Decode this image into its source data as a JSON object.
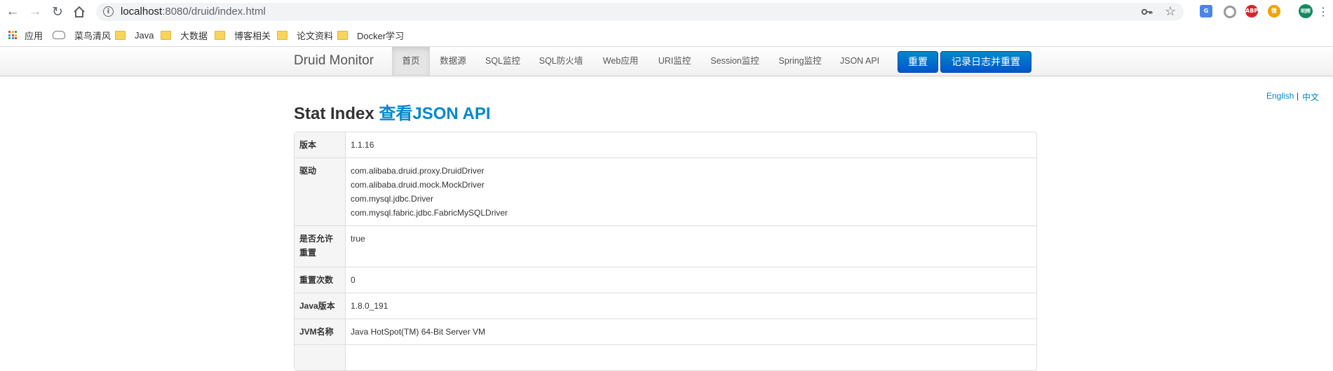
{
  "browser": {
    "url_host": "localhost",
    "url_rest": ":8080/druid/index.html",
    "bookmarks": [
      {
        "label": "应用",
        "icon": "apps-grid-icon"
      },
      {
        "label": "菜鸟清风",
        "icon": "cloud-icon"
      },
      {
        "label": "Java",
        "icon": "folder-icon"
      },
      {
        "label": "大数据",
        "icon": "folder-icon"
      },
      {
        "label": "博客相关",
        "icon": "folder-icon"
      },
      {
        "label": "论文资料",
        "icon": "folder-icon"
      },
      {
        "label": "Docker学习",
        "icon": "folder-icon"
      }
    ],
    "extensions": {
      "abp": "ABP",
      "profile": "明辉"
    }
  },
  "druid": {
    "brand": "Druid Monitor",
    "nav": [
      "首页",
      "数据源",
      "SQL监控",
      "SQL防火墙",
      "Web应用",
      "URI监控",
      "Session监控",
      "Spring监控",
      "JSON API"
    ],
    "reset_button": "重置",
    "log_reset_button": "记录日志并重置"
  },
  "lang": {
    "english": "English",
    "separator": "|",
    "chinese": "中文"
  },
  "page": {
    "title": "Stat Index",
    "json_link": "查看JSON API"
  },
  "stats": {
    "version": {
      "label": "版本",
      "value": "1.1.16"
    },
    "drivers": {
      "label": "驱动",
      "values": [
        "com.alibaba.druid.proxy.DruidDriver",
        "com.alibaba.druid.mock.MockDriver",
        "com.mysql.jdbc.Driver",
        "com.mysql.fabric.jdbc.FabricMySQLDriver"
      ]
    },
    "reset_enable": {
      "label": "是否允许重置",
      "value": "true"
    },
    "reset_count": {
      "label": "重置次数",
      "value": "0"
    },
    "java_version": {
      "label": "Java版本",
      "value": "1.8.0_191"
    },
    "jvm_name": {
      "label": "JVM名称",
      "value": "Java HotSpot(TM) 64-Bit Server VM"
    }
  },
  "colors": {
    "accent": "#0088cc",
    "button": "#0066cc"
  }
}
